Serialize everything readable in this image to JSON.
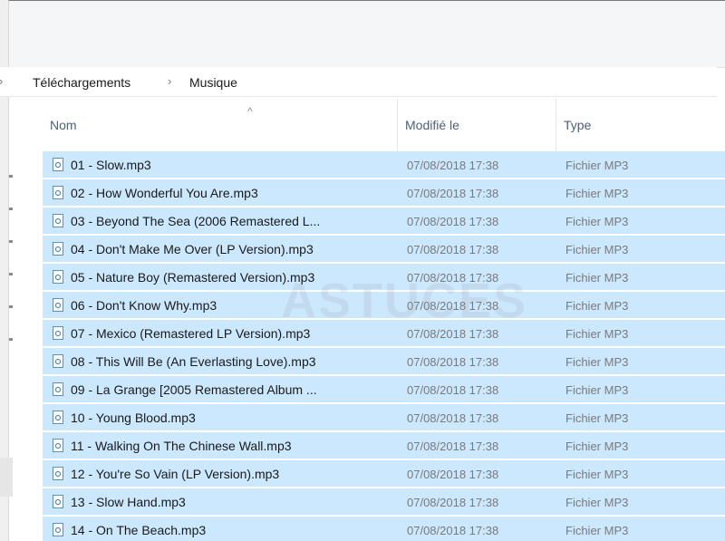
{
  "breadcrumb": {
    "items": [
      "Téléchargements",
      "Musique"
    ]
  },
  "columns": {
    "name": "Nom",
    "modified": "Modifié le",
    "type": "Type"
  },
  "watermark": "ASTUCES",
  "files": [
    {
      "name": "01 - Slow.mp3",
      "modified": "07/08/2018 17:38",
      "type": "Fichier MP3"
    },
    {
      "name": "02 - How Wonderful You Are.mp3",
      "modified": "07/08/2018 17:38",
      "type": "Fichier MP3"
    },
    {
      "name": "03 - Beyond The Sea (2006 Remastered L...",
      "modified": "07/08/2018 17:38",
      "type": "Fichier MP3"
    },
    {
      "name": "04 - Don't Make Me Over (LP Version).mp3",
      "modified": "07/08/2018 17:38",
      "type": "Fichier MP3"
    },
    {
      "name": "05 - Nature Boy (Remastered Version).mp3",
      "modified": "07/08/2018 17:38",
      "type": "Fichier MP3"
    },
    {
      "name": "06 - Don't Know Why.mp3",
      "modified": "07/08/2018 17:38",
      "type": "Fichier MP3"
    },
    {
      "name": "07 - Mexico (Remastered LP Version).mp3",
      "modified": "07/08/2018 17:38",
      "type": "Fichier MP3"
    },
    {
      "name": "08 - This Will Be (An Everlasting Love).mp3",
      "modified": "07/08/2018 17:38",
      "type": "Fichier MP3"
    },
    {
      "name": "09 - La Grange [2005 Remastered Album ...",
      "modified": "07/08/2018 17:38",
      "type": "Fichier MP3"
    },
    {
      "name": "10 - Young Blood.mp3",
      "modified": "07/08/2018 17:38",
      "type": "Fichier MP3"
    },
    {
      "name": "11 - Walking On The Chinese Wall.mp3",
      "modified": "07/08/2018 17:38",
      "type": "Fichier MP3"
    },
    {
      "name": "12 - You're So Vain (LP Version).mp3",
      "modified": "07/08/2018 17:38",
      "type": "Fichier MP3"
    },
    {
      "name": "13 - Slow Hand.mp3",
      "modified": "07/08/2018 17:38",
      "type": "Fichier MP3"
    },
    {
      "name": "14 - On The Beach.mp3",
      "modified": "07/08/2018 17:38",
      "type": "Fichier MP3"
    }
  ],
  "colors": {
    "selection": "#cce8ff",
    "header_text": "#4c607a"
  }
}
